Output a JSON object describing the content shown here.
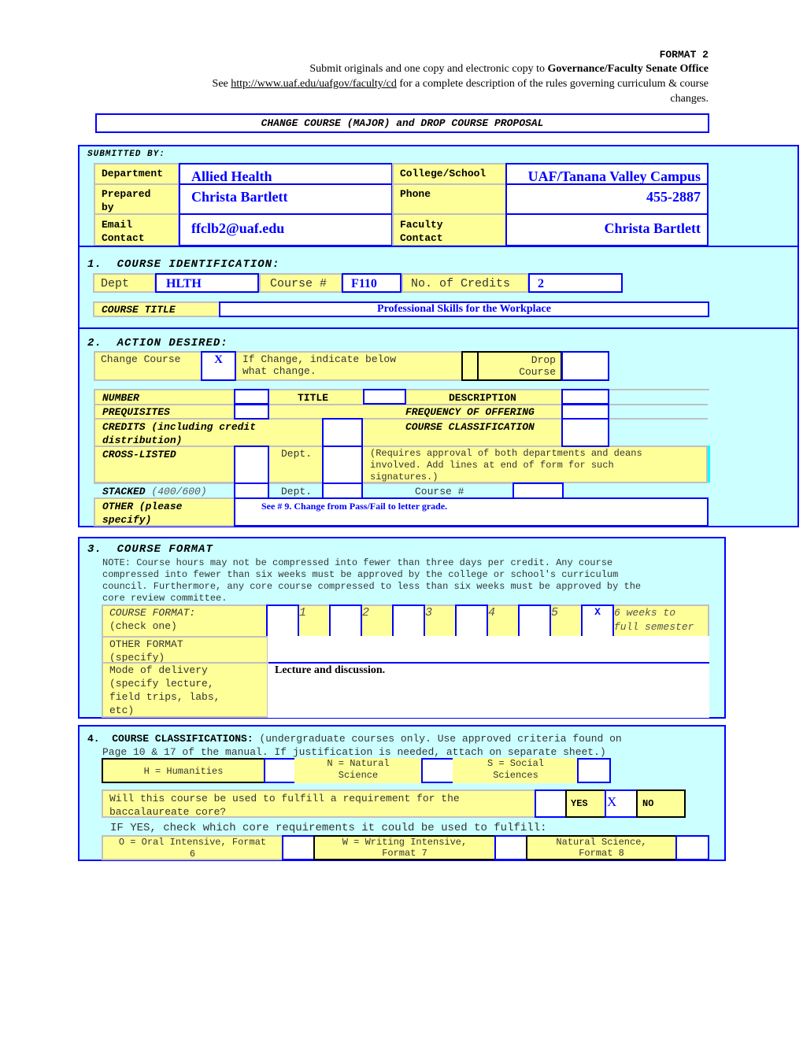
{
  "header": {
    "format": "FORMAT 2",
    "submit_prefix": "Submit originals and one copy and electronic copy to ",
    "submit_office": "Governance/Faculty Senate Office",
    "see_prefix": "See ",
    "see_link": "http://www.uaf.edu/uafgov/faculty/cd",
    "see_suffix": " for a complete description of the rules governing curriculum & course",
    "see_suffix2": "changes.",
    "form_title": "CHANGE COURSE (MAJOR) and DROP COURSE PROPOSAL"
  },
  "submitted_by": {
    "heading": "SUBMITTED BY:",
    "department_label": "Department",
    "department_value": "Allied Health",
    "college_label": "College/School",
    "college_value": "UAF/Tanana Valley Campus",
    "prepared_label_1": "Prepared",
    "prepared_label_2": "by",
    "prepared_value": "Christa Bartlett",
    "phone_label": "Phone",
    "phone_value": "455-2887",
    "email_label_1": "Email",
    "email_label_2": "Contact",
    "email_value": "ffclb2@uaf.edu",
    "faculty_label_1": "Faculty",
    "faculty_label_2": "Contact",
    "faculty_value": "Christa Bartlett"
  },
  "course_identification": {
    "heading_num": "1.",
    "heading": "COURSE IDENTIFICATION:",
    "dept_label": "Dept",
    "dept_value": "HLTH",
    "course_label": "Course #",
    "course_value": "F110",
    "credits_label": "No. of Credits",
    "credits_value": "2",
    "title_label": "COURSE TITLE",
    "title_value": "Professional Skills for the Workplace"
  },
  "action_desired": {
    "heading_num": "2.",
    "heading": "ACTION DESIRED:",
    "change_label": "Change Course",
    "change_value": "X",
    "if_change_1": "If Change, indicate below",
    "if_change_2": "what change.",
    "drop_label_1": "Drop",
    "drop_label_2": "Course",
    "drop_value": "",
    "number_label": "NUMBER",
    "title_label": "TITLE",
    "description_label": "DESCRIPTION",
    "prerequisites_label": "PREQUISITES",
    "frequency_label": "FREQUENCY OF OFFERING",
    "credits_label_1": "CREDITS (including credit",
    "credits_label_2": "distribution)",
    "classification_label": "COURSE CLASSIFICATION",
    "crosslisted_label": "CROSS-LISTED",
    "dept_label": "Dept.",
    "crosslisted_note_1": "(Requires approval of both departments and deans",
    "crosslisted_note_2": "involved.  Add lines at end of form for such",
    "crosslisted_note_3": "signatures.)",
    "stacked_label": "STACKED",
    "stacked_sub": "(400/600)",
    "course_num_label": "Course #",
    "other_label_1": "OTHER (please",
    "other_label_2": "specify)",
    "other_value": "See # 9.  Change from Pass/Fail to letter grade."
  },
  "course_format": {
    "heading_num": "3.",
    "heading": "COURSE FORMAT",
    "note_1": "NOTE: Course hours may not be compressed into fewer than three days per credit. Any course",
    "note_2": "compressed into fewer than six weeks must be approved by the college or school's curriculum",
    "note_3": "council. Furthermore, any core course compressed to less than six weeks must be approved by the",
    "note_4": "core review committee.",
    "format_label_1": "COURSE FORMAT:",
    "format_label_2": "(check one)",
    "options": [
      {
        "label": "1",
        "checked": ""
      },
      {
        "label": "2",
        "checked": ""
      },
      {
        "label": "3",
        "checked": ""
      },
      {
        "label": "4",
        "checked": ""
      },
      {
        "label": "5",
        "checked": ""
      },
      {
        "label_1": "6 weeks to",
        "label_2": "full semester",
        "checked": "X"
      }
    ],
    "other_label_1": "OTHER FORMAT",
    "other_label_2": "(specify)",
    "other_value": "",
    "mode_label_1": "Mode of delivery",
    "mode_label_2": "(specify lecture,",
    "mode_label_3": "field trips, labs,",
    "mode_label_4": "etc)",
    "mode_value": "Lecture and discussion."
  },
  "classifications": {
    "heading_num": "4.",
    "heading": "COURSE CLASSIFICATIONS:",
    "heading_note_1": " (undergraduate courses only. Use approved criteria found on",
    "heading_note_2": "Page 10 & 17 of the manual.  If justification is needed, attach on separate sheet.)",
    "humanities": "H = Humanities",
    "natural_1": "N = Natural",
    "natural_2": "Science",
    "social_1": "S = Social",
    "social_2": "Sciences",
    "core_q_1": "Will this course be used to fulfill a requirement for the",
    "core_q_2": "baccalaureate core?",
    "yes_label": "YES",
    "yes_value": "",
    "no_value": "X",
    "no_label": "NO",
    "if_yes": "IF YES, check which core requirements it could be used to fulfill:",
    "oral_1": "O = Oral Intensive, Format",
    "oral_2": "6",
    "writing_1": "W = Writing Intensive,",
    "writing_2": "Format 7",
    "natsci_1": "Natural Science,",
    "natsci_2": "Format 8"
  }
}
